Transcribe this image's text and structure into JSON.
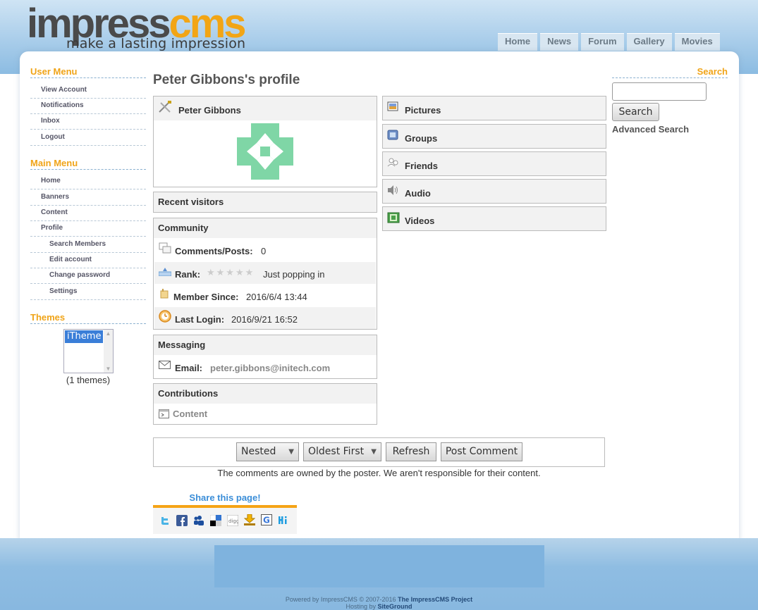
{
  "header": {
    "logo_word1": "impress",
    "logo_word2": "cms",
    "logo_tagline": "make a lasting impression",
    "nav": [
      "Home",
      "News",
      "Forum",
      "Gallery",
      "Movies"
    ]
  },
  "left": {
    "user_menu": {
      "title": "User Menu",
      "items": [
        "View Account",
        "Notifications",
        "Inbox",
        "Logout"
      ]
    },
    "main_menu": {
      "title": "Main Menu",
      "items": [
        "Home",
        "Banners",
        "Content",
        "Profile"
      ],
      "sub_items": [
        "Search Members",
        "Edit account",
        "Change password",
        "Settings"
      ]
    },
    "themes": {
      "title": "Themes",
      "selected": "iTheme",
      "count_text": "(1 themes)"
    }
  },
  "profile": {
    "title": "Peter Gibbons's profile",
    "name": "Peter Gibbons",
    "recent_visitors_label": "Recent visitors",
    "community": {
      "title": "Community",
      "posts_label": "Comments/Posts:",
      "posts_value": "0",
      "rank_label": "Rank:",
      "rank_text": "Just popping in",
      "rank_stars": 0,
      "since_label": "Member Since:",
      "since_value": "2016/6/4 13:44",
      "login_label": "Last Login:",
      "login_value": "2016/9/21 16:52"
    },
    "messaging": {
      "title": "Messaging",
      "email_label": "Email:",
      "email_value": "peter.gibbons@initech.com"
    },
    "contributions": {
      "title": "Contributions",
      "content_label": "Content"
    },
    "media": [
      "Pictures",
      "Groups",
      "Friends",
      "Audio",
      "Videos"
    ]
  },
  "comments": {
    "mode": "Nested",
    "order": "Oldest First",
    "refresh": "Refresh",
    "post": "Post Comment",
    "disclaimer": "The comments are owned by the poster. We aren't responsible for their content."
  },
  "share": {
    "title": "Share this page!",
    "icons": [
      "twitter-icon",
      "facebook-icon",
      "myspace-icon",
      "delicious-icon",
      "digg-icon",
      "stumble-icon",
      "google-icon",
      "hi5-icon"
    ]
  },
  "search": {
    "title": "Search",
    "button": "Search",
    "advanced": "Advanced Search"
  },
  "footer": {
    "powered_prefix": "Powered by ImpressCMS © 2007-2016",
    "powered_link": "The ImpressCMS Project",
    "hosting_prefix": "Hosting by",
    "hosting_link": "SiteGround"
  },
  "colors": {
    "accent": "#f0a418",
    "header_blue": "#8cbce2",
    "share_bar": "#f5a416",
    "theme_select": "#3a7ed8"
  }
}
